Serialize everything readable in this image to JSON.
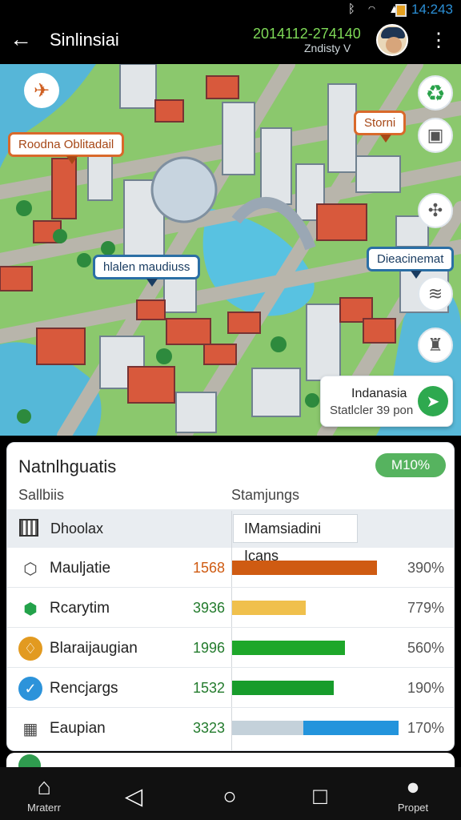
{
  "status": {
    "time": "14:243",
    "icons": [
      "bluetooth-icon",
      "wifi-icon",
      "signal-icon",
      "battery-icon"
    ]
  },
  "app_bar": {
    "title": "Sinlinsiai",
    "date": "2014112-274140",
    "subtitle": "Zndisty V"
  },
  "map": {
    "labels": [
      {
        "text": "Roodna Oblitadail",
        "style": "orange"
      },
      {
        "text": "Storni",
        "style": "orange"
      },
      {
        "text": "hlalen maudiuss",
        "style": "blue"
      },
      {
        "text": "Dieacinemat",
        "style": "blue"
      }
    ],
    "info_card": {
      "title": "Indanasia",
      "subtitle": "Statlcler 39 pon"
    }
  },
  "panel": {
    "title": "Natnlhguatis",
    "badge": "M10%",
    "left_heading": "Sallbiis",
    "right_heading": "Stamjungs",
    "filter_label": "Dhoolax",
    "filter_value": "IMamsiadini Icans",
    "rows": [
      {
        "name": "Mauljatie",
        "value": "1568",
        "percent": "390%",
        "color": "#cf5b12",
        "bar_fraction": 0.87
      },
      {
        "name": "Rcarytim",
        "value": "3936",
        "percent": "779%",
        "color": "#f0c04c",
        "bar_fraction": 0.44
      },
      {
        "name": "Blaraijaugian",
        "value": "1996",
        "percent": "560%",
        "color": "#1ea72a",
        "bar_fraction": 0.68
      },
      {
        "name": "Rencjargs",
        "value": "1532",
        "percent": "190%",
        "color": "#179c2b",
        "bar_fraction": 0.61
      },
      {
        "name": "Eaupian",
        "value": "3323",
        "percent": "170%",
        "color": "#2394dc",
        "bar_fraction": 1.0
      }
    ]
  },
  "nav": {
    "left": "Mraterr",
    "right": "Propet"
  }
}
